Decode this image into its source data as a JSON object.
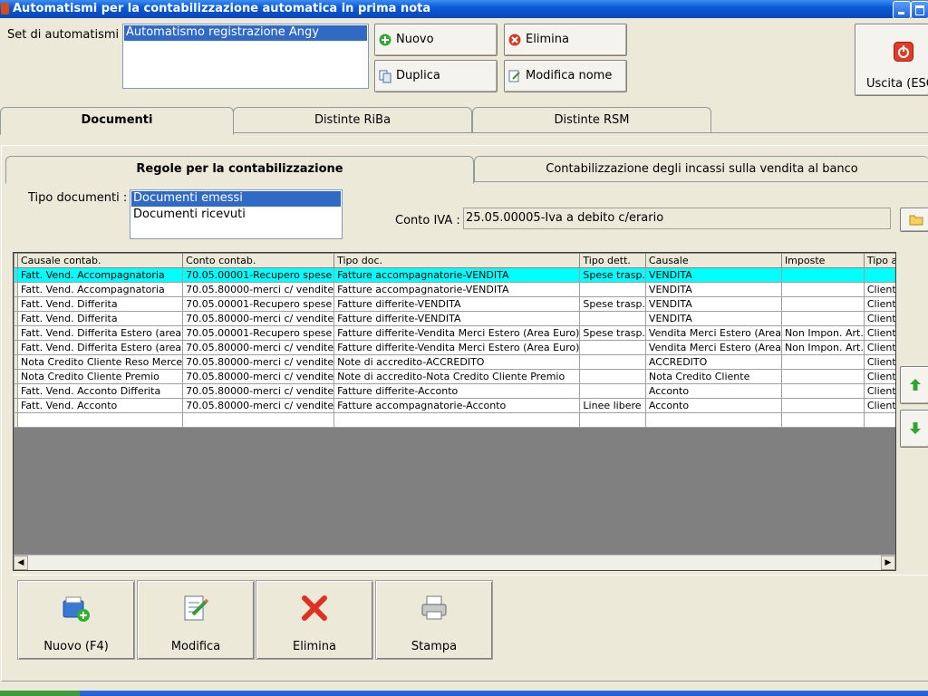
{
  "window": {
    "title": "Automatismi per la contabilizzazione automatica in prima nota"
  },
  "set": {
    "label": "Set di automatismi :",
    "items": [
      "Automatismo registrazione Angy"
    ],
    "selected": 0
  },
  "set_buttons": {
    "nuovo": "Nuovo",
    "elimina": "Elimina",
    "duplica": "Duplica",
    "modifica_nome": "Modifica nome"
  },
  "exit_button": "Uscita (ESC)",
  "main_tabs": [
    "Documenti",
    "Distinte RiBa",
    "Distinte RSM"
  ],
  "sub_tabs": [
    "Regole per la contabilizzazione",
    "Contabilizzazione degli incassi sulla vendita al banco"
  ],
  "tipo_documenti": {
    "label": "Tipo documenti :",
    "items": [
      "Documenti emessi",
      "Documenti ricevuti"
    ],
    "selected": 0
  },
  "conto_iva": {
    "label": "Conto IVA :",
    "value": "25.05.00005-Iva a debito c/erario"
  },
  "grid": {
    "columns": [
      "Causale contab.",
      "Conto contab.",
      "Tipo doc.",
      "Tipo dett.",
      "Causale",
      "Imposte",
      "Tipo anag."
    ],
    "rows": [
      [
        "Fatt. Vend. Accompagnatoria",
        "70.05.00001-Recupero spese",
        "Fatture accompagnatorie-VENDITA",
        "Spese trasp.",
        "VENDITA",
        "",
        ""
      ],
      [
        "Fatt. Vend. Accompagnatoria",
        "70.05.80000-merci c/ vendite",
        "Fatture accompagnatorie-VENDITA",
        "",
        "VENDITA",
        "",
        "Clienti"
      ],
      [
        "Fatt. Vend. Differita",
        "70.05.00001-Recupero spese",
        "Fatture differite-VENDITA",
        "Spese trasp.",
        "VENDITA",
        "",
        "Clienti"
      ],
      [
        "Fatt. Vend. Differita",
        "70.05.80000-merci c/ vendite",
        "Fatture differite-VENDITA",
        "",
        "VENDITA",
        "",
        "Clienti"
      ],
      [
        "Fatt. Vend. Differita Estero (area",
        "70.05.00001-Recupero spese",
        "Fatture differite-Vendita Merci Estero (Area Euro)",
        "Spese trasp.",
        "Vendita Merci Estero (Area",
        "Non Impon. Art.",
        "Clienti"
      ],
      [
        "Fatt. Vend. Differita Estero (area",
        "70.05.80000-merci c/ vendite",
        "Fatture differite-Vendita Merci Estero (Area Euro)",
        "",
        "Vendita Merci Estero (Area",
        "Non Impon. Art.",
        "Clienti"
      ],
      [
        "Nota Credito Cliente Reso Merce",
        "70.05.80000-merci c/ vendite",
        "Note di accredito-ACCREDITO",
        "",
        "ACCREDITO",
        "",
        "Clienti"
      ],
      [
        "Nota Credito Cliente Premio",
        "70.05.80000-merci c/ vendite",
        "Note di accredito-Nota Credito Cliente Premio",
        "",
        "Nota Credito Cliente",
        "",
        "Clienti"
      ],
      [
        "Fatt. Vend. Acconto Differita",
        "70.05.80000-merci c/ vendite",
        "Fatture differite-Acconto",
        "",
        "Acconto",
        "",
        "Clienti"
      ],
      [
        "Fatt. Vend. Acconto",
        "70.05.80000-merci c/ vendite",
        "Fatture accompagnatorie-Acconto",
        "Linee libere",
        "Acconto",
        "",
        "Clienti"
      ],
      [
        "",
        "",
        "",
        "",
        "",
        "",
        ""
      ]
    ],
    "highlighted_row": 0
  },
  "bottom_buttons": [
    "Nuovo (F4)",
    "Modifica",
    "Elimina",
    "Stampa"
  ],
  "colors": {
    "title_bar": "#0a5bd6",
    "selection": "#316ac5",
    "row_highlight": "#00ffff"
  }
}
